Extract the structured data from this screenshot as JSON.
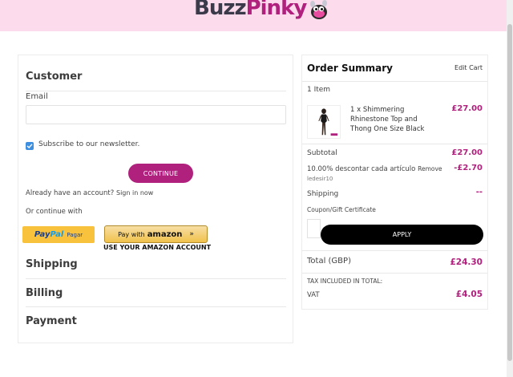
{
  "header": {
    "logo_part1": "Buzz",
    "logo_part2": "Pinky",
    "bg_color": "#fcdcec",
    "brand_color": "#b0217d"
  },
  "customer": {
    "title": "Customer",
    "email_label": "Email",
    "email_value": "",
    "newsletter_label": "Subscribe to our newsletter.",
    "newsletter_checked": true,
    "continue_label": "CONTINUE",
    "signin_prompt": "Already have an account?",
    "signin_link": "Sign in now",
    "or_continue": "Or continue with",
    "paypal_label": "Pagar",
    "paypal_pay": "Pay",
    "paypal_pal": "Pal",
    "amazon_prefix": "Pay with",
    "amazon_brand": "amazon",
    "amazon_caption": "USE YOUR AMAZON ACCOUNT"
  },
  "sections": {
    "shipping": "Shipping",
    "billing": "Billing",
    "payment": "Payment"
  },
  "summary": {
    "title": "Order Summary",
    "edit_cart": "Edit Cart",
    "item_count": "1 Item",
    "item_name": "1 x Shimmering Rhinestone Top and Thong One Size Black",
    "item_price": "£27.00",
    "subtotal_label": "Subtotal",
    "subtotal_value": "£27.00",
    "discount_label": "10.00% descontar cada artículo",
    "discount_remove": "Remove",
    "discount_code": "ledesir10",
    "discount_value": "-£2.70",
    "shipping_label": "Shipping",
    "shipping_value": "--",
    "coupon_label": "Coupon/Gift Certificate",
    "apply_label": "APPLY",
    "total_label": "Total (GBP)",
    "total_value": "£24.30",
    "tax_heading": "TAX INCLUDED IN TOTAL:",
    "vat_label": "VAT",
    "vat_value": "£4.05"
  }
}
